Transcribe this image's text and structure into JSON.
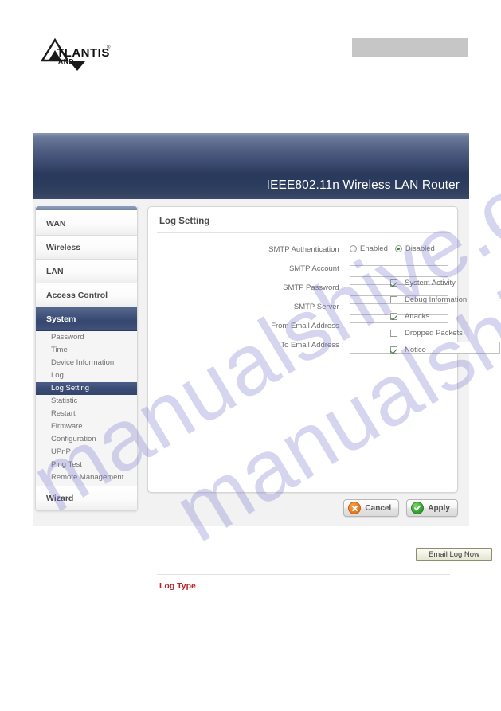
{
  "brand": {
    "logo_name": "ATLANTIS",
    "logo_sub": "LAND",
    "logo_tm": "®"
  },
  "watermark": {
    "line1": "manualshive.com",
    "line2": "manualshive.com"
  },
  "header": {
    "title": "IEEE802.11n  Wireless LAN Router"
  },
  "sidebar": {
    "main_items": [
      {
        "label": "WAN",
        "active": false
      },
      {
        "label": "Wireless",
        "active": false
      },
      {
        "label": "LAN",
        "active": false
      },
      {
        "label": "Access Control",
        "active": false
      },
      {
        "label": "System",
        "active": true
      }
    ],
    "sub_items": [
      {
        "label": "Password",
        "active": false
      },
      {
        "label": "Time",
        "active": false
      },
      {
        "label": "Device Information",
        "active": false
      },
      {
        "label": "Log",
        "active": false
      },
      {
        "label": "Log Setting",
        "active": true
      },
      {
        "label": "Statistic",
        "active": false
      },
      {
        "label": "Restart",
        "active": false
      },
      {
        "label": "Firmware",
        "active": false
      },
      {
        "label": "Configuration",
        "active": false
      },
      {
        "label": "UPnP",
        "active": false
      },
      {
        "label": "Ping Test",
        "active": false
      },
      {
        "label": "Remote Management",
        "active": false
      }
    ],
    "wizard": {
      "label": "Wizard",
      "active": false
    }
  },
  "panel": {
    "title": "Log Setting",
    "smtp_auth": {
      "label": "SMTP Authentication :",
      "options": [
        {
          "label": "Enabled",
          "selected": false
        },
        {
          "label": "Disabled",
          "selected": true
        }
      ]
    },
    "fields": [
      {
        "label": "SMTP Account :",
        "value": "",
        "placeholder": "",
        "width": "narrow"
      },
      {
        "label": "SMTP Password :",
        "value": "",
        "placeholder": "",
        "width": "narrow"
      },
      {
        "label": "SMTP Server :",
        "value": "",
        "placeholder": "",
        "width": "narrow"
      },
      {
        "label": "From Email Address :",
        "value": "",
        "placeholder": "",
        "width": "narrow"
      },
      {
        "label": "To Email Address :",
        "value": "",
        "placeholder": "",
        "width": "wide"
      }
    ],
    "email_log_button": "Email Log Now",
    "log_type": {
      "title": "Log Type",
      "items": [
        {
          "label": "System Activity",
          "checked": true
        },
        {
          "label": "Debug Information",
          "checked": false
        },
        {
          "label": "Attacks",
          "checked": true
        },
        {
          "label": "Dropped Packets",
          "checked": false
        },
        {
          "label": "Notice",
          "checked": true
        }
      ]
    }
  },
  "actions": {
    "cancel_label": "Cancel",
    "apply_label": "Apply"
  },
  "colors": {
    "accent_navy": "#35476f",
    "log_type_red": "#b62525",
    "cancel_orange": "#ef7f22",
    "apply_green": "#3ba832",
    "watermark_purple": "#7873cd"
  }
}
